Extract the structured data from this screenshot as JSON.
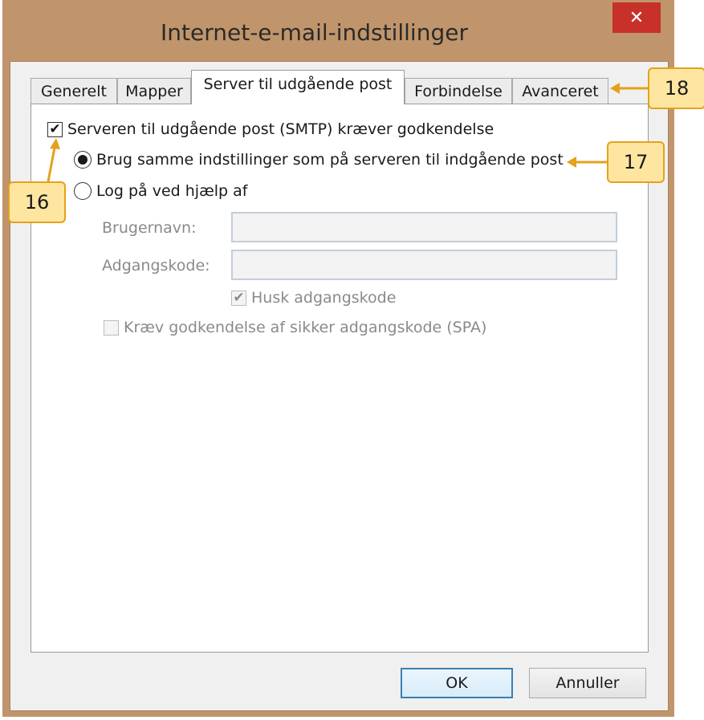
{
  "window": {
    "title": "Internet-e-mail-indstillinger",
    "close_glyph": "✕"
  },
  "tabs": [
    {
      "label": "Generelt",
      "active": false
    },
    {
      "label": "Mapper",
      "active": false
    },
    {
      "label": "Server til udgående post",
      "active": true
    },
    {
      "label": "Forbindelse",
      "active": false
    },
    {
      "label": "Avanceret",
      "active": false
    }
  ],
  "smtp": {
    "requires_auth_label": "Serveren til udgående post (SMTP) kræver godkendelse",
    "requires_auth_checked": true,
    "same_settings_label": "Brug samme indstillinger som på serveren til indgående post",
    "same_settings_selected": true,
    "login_with_label": "Log på ved hjælp af",
    "login_with_selected": false,
    "username_label": "Brugernavn:",
    "username_value": "",
    "password_label": "Adgangskode:",
    "password_value": "",
    "remember_password_label": "Husk adgangskode",
    "remember_password_checked": true,
    "spa_label": "Kræv godkendelse af sikker adgangskode (SPA)",
    "spa_checked": false
  },
  "buttons": {
    "ok": "OK",
    "cancel": "Annuller"
  },
  "callouts": {
    "c16": "16",
    "c17": "17",
    "c18": "18"
  },
  "colors": {
    "accent_callout": "#e4a21a",
    "callout_fill": "#fee6a0",
    "window_frame": "#c1956b",
    "close": "#c7312a"
  }
}
